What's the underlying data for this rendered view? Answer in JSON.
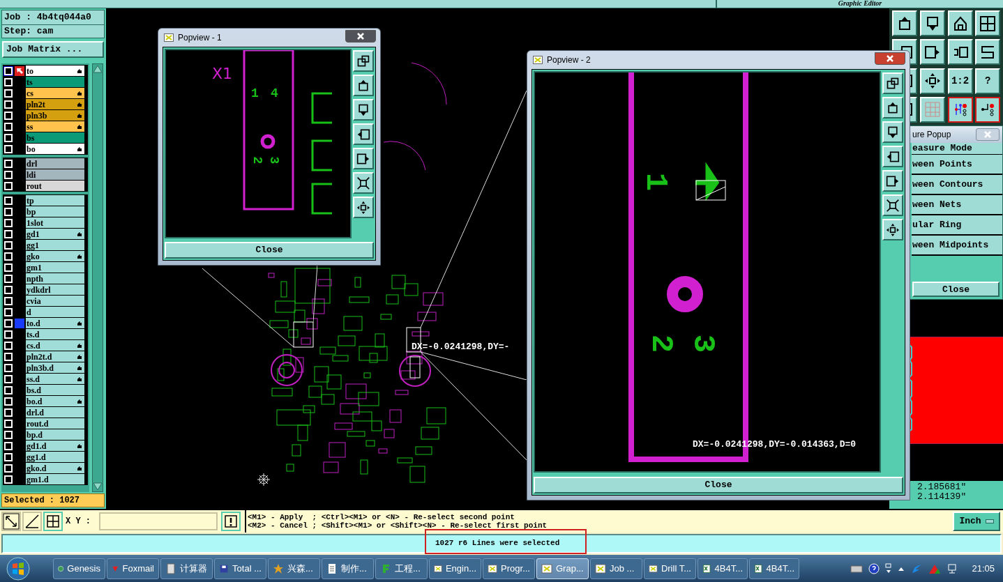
{
  "app_title": "Graphic Editor",
  "job": {
    "job_label": "Job : 4b4tq044a0",
    "step_label": "Step: cam",
    "matrix_button": "Job Matrix ..."
  },
  "layer_groups": [
    {
      "layers": [
        {
          "name": "to",
          "color": "#ffffff",
          "hand": true,
          "work": true,
          "display": false
        },
        {
          "name": "ts",
          "color": "#0a9a78",
          "hand": false,
          "work": false,
          "display": false
        },
        {
          "name": "cs",
          "color": "#ffc34d",
          "hand": true,
          "work": false,
          "display": false
        },
        {
          "name": "pln2t",
          "color": "#d4a010",
          "hand": true,
          "work": false,
          "display": false
        },
        {
          "name": "pln3b",
          "color": "#d4a010",
          "hand": true,
          "work": false,
          "display": false
        },
        {
          "name": "ss",
          "color": "#ffc34d",
          "hand": true,
          "work": false,
          "display": false
        },
        {
          "name": "bs",
          "color": "#0a9a78",
          "hand": false,
          "work": false,
          "display": false
        },
        {
          "name": "bo",
          "color": "#ffffff",
          "hand": true,
          "work": false,
          "display": false
        }
      ]
    },
    {
      "layers": [
        {
          "name": "drl",
          "color": "#a3b5bd",
          "hand": false,
          "work": false,
          "display": false
        },
        {
          "name": "ldi",
          "color": "#a3b5bd",
          "hand": false,
          "work": false,
          "display": false
        },
        {
          "name": "rout",
          "color": "#d8d8d8",
          "hand": false,
          "work": false,
          "display": false
        }
      ]
    },
    {
      "layers": [
        {
          "name": "tp",
          "color": "#a0dcd8",
          "hand": false,
          "work": false,
          "display": false
        },
        {
          "name": "bp",
          "color": "#a0dcd8",
          "hand": false,
          "work": false,
          "display": false
        },
        {
          "name": "1slot",
          "color": "#a0dcd8",
          "hand": false,
          "work": false,
          "display": false
        },
        {
          "name": "gd1",
          "color": "#a0dcd8",
          "hand": true,
          "work": false,
          "display": false
        },
        {
          "name": "gg1",
          "color": "#a0dcd8",
          "hand": false,
          "work": false,
          "display": false
        },
        {
          "name": "gko",
          "color": "#a0dcd8",
          "hand": true,
          "work": false,
          "display": false
        },
        {
          "name": "gm1",
          "color": "#a0dcd8",
          "hand": false,
          "work": false,
          "display": false
        },
        {
          "name": "npth",
          "color": "#a0dcd8",
          "hand": false,
          "work": false,
          "display": false
        },
        {
          "name": "ydkdrl",
          "color": "#a0dcd8",
          "hand": false,
          "work": false,
          "display": false
        },
        {
          "name": "cvia",
          "color": "#a0dcd8",
          "hand": false,
          "work": false,
          "display": false
        },
        {
          "name": "d",
          "color": "#a0dcd8",
          "hand": false,
          "work": false,
          "display": false
        },
        {
          "name": "to.d",
          "color": "#a0dcd8",
          "hand": true,
          "work": false,
          "display": true
        },
        {
          "name": "ts.d",
          "color": "#a0dcd8",
          "hand": false,
          "work": false,
          "display": false
        },
        {
          "name": "cs.d",
          "color": "#a0dcd8",
          "hand": true,
          "work": false,
          "display": false
        },
        {
          "name": "pln2t.d",
          "color": "#a0dcd8",
          "hand": true,
          "work": false,
          "display": false
        },
        {
          "name": "pln3b.d",
          "color": "#a0dcd8",
          "hand": true,
          "work": false,
          "display": false
        },
        {
          "name": "ss.d",
          "color": "#a0dcd8",
          "hand": true,
          "work": false,
          "display": false
        },
        {
          "name": "bs.d",
          "color": "#a0dcd8",
          "hand": false,
          "work": false,
          "display": false
        },
        {
          "name": "bo.d",
          "color": "#a0dcd8",
          "hand": true,
          "work": false,
          "display": false
        },
        {
          "name": "drl.d",
          "color": "#a0dcd8",
          "hand": false,
          "work": false,
          "display": false
        },
        {
          "name": "rout.d",
          "color": "#a0dcd8",
          "hand": false,
          "work": false,
          "display": false
        },
        {
          "name": "bp.d",
          "color": "#a0dcd8",
          "hand": false,
          "work": false,
          "display": false
        },
        {
          "name": "gd1.d",
          "color": "#a0dcd8",
          "hand": true,
          "work": false,
          "display": false
        },
        {
          "name": "gg1.d",
          "color": "#a0dcd8",
          "hand": false,
          "work": false,
          "display": false
        },
        {
          "name": "gko.d",
          "color": "#a0dcd8",
          "hand": true,
          "work": false,
          "display": false
        },
        {
          "name": "gm1.d",
          "color": "#a0dcd8",
          "hand": false,
          "work": false,
          "display": false
        }
      ]
    }
  ],
  "selected_count": "Selected : 1027",
  "canvas": {
    "measure_text": "DX=-0.0241298,DY=-"
  },
  "toolbar": [
    {
      "kind": "pop-up",
      "active": false
    },
    {
      "kind": "pop-down",
      "active": false
    },
    {
      "kind": "home",
      "active": false
    },
    {
      "kind": "xy-grid",
      "active": false
    },
    {
      "kind": "left-box",
      "active": false
    },
    {
      "kind": "right-box",
      "active": false
    },
    {
      "kind": "undo",
      "active": false
    },
    {
      "kind": "s-curve",
      "active": false
    },
    {
      "kind": "left-box",
      "active": false
    },
    {
      "kind": "zoom-center",
      "active": false
    },
    {
      "kind": "label",
      "label": "1:2",
      "active": false
    },
    {
      "kind": "label",
      "label": "?",
      "active": false
    },
    {
      "kind": "left-box",
      "active": false
    },
    {
      "kind": "grid",
      "active": false
    },
    {
      "kind": "net-a",
      "active": true
    },
    {
      "kind": "net-b",
      "active": true
    }
  ],
  "measure_popup": {
    "title": "ure Popup",
    "header": "easure Mode",
    "options": [
      "ween Points",
      "ween Contours",
      "ween Nets",
      "ular Ring",
      "ween Midpoints"
    ],
    "close": "Close"
  },
  "coordinates": [
    "2.185681\"",
    "2.114139\""
  ],
  "popviews": [
    {
      "title": "Popview - 1",
      "active": false,
      "labels": [
        "X1",
        "1",
        "4",
        "2",
        "3"
      ],
      "close": "Close",
      "tools": [
        {
          "kind": "copy"
        },
        {
          "kind": "pop-up"
        },
        {
          "kind": "pop-down"
        },
        {
          "kind": "left-box"
        },
        {
          "kind": "right-box"
        },
        {
          "kind": "zoom-fit"
        },
        {
          "kind": "zoom-center"
        }
      ]
    },
    {
      "title": "Popview - 2",
      "active": true,
      "labels": [
        "1",
        "2",
        "3"
      ],
      "measure": "DX=-0.0241298,DY=-0.014363,D=0",
      "close": "Close",
      "tools": [
        {
          "kind": "copy"
        },
        {
          "kind": "pop-up"
        },
        {
          "kind": "pop-down"
        },
        {
          "kind": "left-box"
        },
        {
          "kind": "right-box"
        },
        {
          "kind": "zoom-fit"
        },
        {
          "kind": "zoom-center"
        }
      ]
    }
  ],
  "command_bar": {
    "xy_label": "X Y :",
    "hints": [
      "<M1> - Apply  ; <Ctrl><M1> or <N> - Re-select second point",
      "<M2> - Cancel ; <Shift><M1> or <Shift><N> - Re-select first point"
    ],
    "unit": "Inch"
  },
  "status": {
    "text": "1027 r6 Lines were selected",
    "highlighted": true
  },
  "taskbar": {
    "items": [
      {
        "label": "Genesis",
        "kind": "globe",
        "selected": false
      },
      {
        "label": "Foxmail",
        "kind": "mail",
        "selected": false
      },
      {
        "label": "计算器",
        "kind": "calc",
        "selected": false
      },
      {
        "label": "Total ...",
        "kind": "disk",
        "selected": false
      },
      {
        "label": "兴森...",
        "kind": "star",
        "selected": false
      },
      {
        "label": "制作...",
        "kind": "doc",
        "selected": false
      },
      {
        "label": "工程...",
        "kind": "f",
        "selected": false
      },
      {
        "label": "Engin...",
        "kind": "x",
        "selected": false
      },
      {
        "label": "Progr...",
        "kind": "x",
        "selected": false
      },
      {
        "label": "Grap...",
        "kind": "x",
        "selected": true
      },
      {
        "label": "Job ...",
        "kind": "x",
        "selected": false
      },
      {
        "label": "Drill T...",
        "kind": "x",
        "selected": false
      },
      {
        "label": "4B4T...",
        "kind": "sheet",
        "selected": false
      },
      {
        "label": "4B4T...",
        "kind": "sheet",
        "selected": false
      }
    ],
    "clock": "21:05"
  }
}
